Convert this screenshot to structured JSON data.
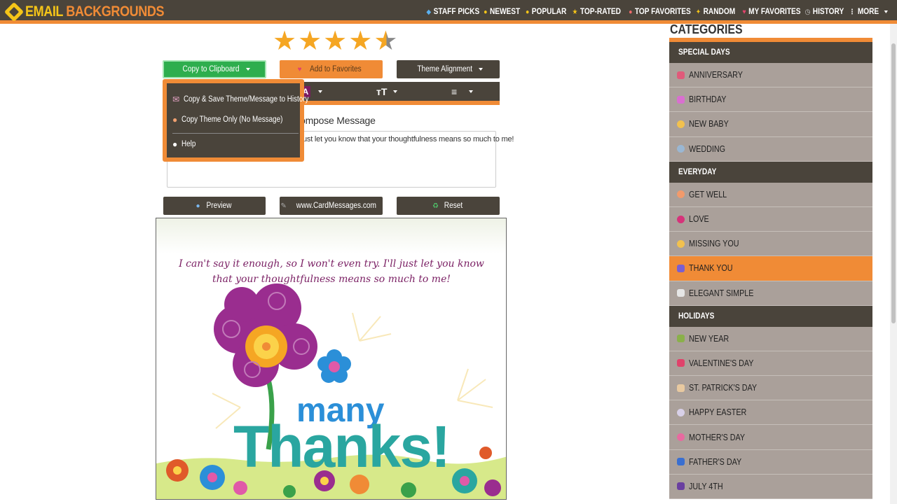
{
  "brand": {
    "part1": "EMAIL",
    "part2": "BACKGROUNDS"
  },
  "nav": [
    {
      "label": "STAFF PICKS",
      "icon": "gem-icon"
    },
    {
      "label": "NEWEST",
      "icon": "sparkle-face-icon"
    },
    {
      "label": "POPULAR",
      "icon": "thumbs-up-icon"
    },
    {
      "label": "TOP-RATED",
      "icon": "star-icon"
    },
    {
      "label": "TOP FAVORITES",
      "icon": "heart-eyes-icon"
    },
    {
      "label": "RANDOM",
      "icon": "sparkles-icon"
    },
    {
      "label": "MY FAVORITES",
      "icon": "heart-icon"
    },
    {
      "label": "HISTORY",
      "icon": "clock-icon"
    },
    {
      "label": "MORE",
      "icon": "dots-icon"
    }
  ],
  "rating": {
    "value": 4.5,
    "max": 5
  },
  "buttons": {
    "copy": "Copy to Clipboard",
    "favorites": "Add to Favorites",
    "theme_alignment": "Theme Alignment",
    "preview": "Preview",
    "site": "www.CardMessages.com",
    "reset": "Reset"
  },
  "toolbar": {
    "font_color": "A",
    "font_size": "ᴛT",
    "align": "≡"
  },
  "dropdown": {
    "items": [
      {
        "label": "Copy & Save Theme/Message to History",
        "icon": "envelope-icon"
      },
      {
        "label": "Copy Theme Only (No Message)",
        "icon": "palette-icon"
      },
      {
        "label": "Help",
        "icon": "lightbulb-icon"
      }
    ]
  },
  "compose": {
    "label": "Compose Message",
    "label_visible": "ompose Message",
    "text_visible": "ust let you know that your thoughtfulness means so much to me!"
  },
  "card": {
    "message": "I can't say it enough, so I won't even try. I'll just let you know that your thoughtfulness means so much to me!",
    "title_line1": "many",
    "title_line2": "Thanks!"
  },
  "sidebar": {
    "title": "CATEGORIES",
    "sections": [
      {
        "title": "SPECIAL DAYS",
        "items": [
          {
            "label": "ANNIVERSARY",
            "color": "#e05a7a"
          },
          {
            "label": "BIRTHDAY",
            "color": "#d96fd0"
          },
          {
            "label": "NEW BABY",
            "color": "#f2c14e"
          },
          {
            "label": "WEDDING",
            "color": "#9ab7d3"
          }
        ]
      },
      {
        "title": "EVERYDAY",
        "items": [
          {
            "label": "GET WELL",
            "color": "#f29a6b"
          },
          {
            "label": "LOVE",
            "color": "#d6337a"
          },
          {
            "label": "MISSING YOU",
            "color": "#f2c14e"
          },
          {
            "label": "THANK YOU",
            "color": "#7a5fd0",
            "active": true
          },
          {
            "label": "ELEGANT SIMPLE",
            "color": "#e6e6e6"
          }
        ]
      },
      {
        "title": "HOLIDAYS",
        "items": [
          {
            "label": "NEW YEAR",
            "color": "#8ab04a"
          },
          {
            "label": "VALENTINE'S DAY",
            "color": "#e0436b"
          },
          {
            "label": "ST. PATRICK'S DAY",
            "color": "#e8c9a0"
          },
          {
            "label": "HAPPY EASTER",
            "color": "#d8d0e8"
          },
          {
            "label": "MOTHER'S DAY",
            "color": "#e86aa0"
          },
          {
            "label": "FATHER'S DAY",
            "color": "#3a6fd0"
          },
          {
            "label": "JULY 4TH",
            "color": "#6a3fa0"
          }
        ]
      }
    ]
  }
}
